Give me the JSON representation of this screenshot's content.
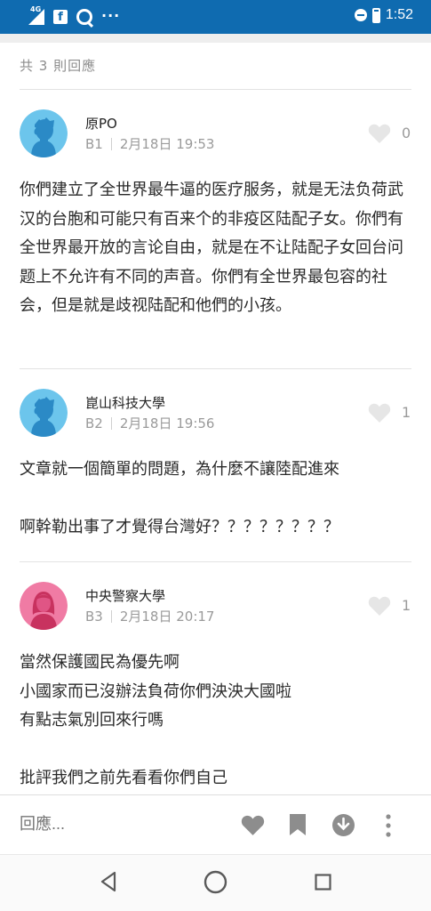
{
  "status_bar": {
    "network": "4G",
    "time": "1:52",
    "icons": [
      "signal-icon",
      "facebook-icon",
      "q-app-icon",
      "more-notifications-icon",
      "do-not-disturb-icon",
      "battery-icon"
    ]
  },
  "reply_count": "共 3 則回應",
  "replies": [
    {
      "author": "原PO",
      "floor": "B1",
      "date": "2月18日 19:53",
      "likes": "0",
      "avatar": "male-avatar-icon",
      "avatar_color": "#6cc5ec",
      "text": "你們建立了全世界最牛逼的医疗服务，就是无法负荷武汉的台胞和可能只有百来个的非疫区陆配子女。你們有全世界最开放的言论自由，就是在不让陆配子女回台问题上不允许有不同的声音。你們有全世界最包容的社会，但是就是歧视陆配和他們的小孩。"
    },
    {
      "author": "崑山科技大學",
      "floor": "B2",
      "date": "2月18日 19:56",
      "likes": "1",
      "avatar": "male-avatar-icon",
      "avatar_color": "#6cc5ec",
      "text": "文章就一個簡單的問題，為什麼不讓陸配進來\n\n啊幹勒出事了才覺得台灣好？？？？？？？？"
    },
    {
      "author": "中央警察大學",
      "floor": "B3",
      "date": "2月18日 20:17",
      "likes": "1",
      "avatar": "female-avatar-icon",
      "avatar_color": "#f07ba4",
      "text": "當然保護國民為優先啊\n小國家而已沒辦法負荷你們泱泱大國啦\n有點志氣別回來行嗎\n\n批評我們之前先看看你們自己"
    }
  ],
  "bottom_bar": {
    "reply_placeholder": "回應...",
    "actions": [
      "like-heart-icon",
      "bookmark-icon",
      "download-icon",
      "more-options-icon"
    ]
  },
  "nav_bar": {
    "buttons": [
      "back-icon",
      "home-icon",
      "recent-apps-icon"
    ]
  },
  "colors": {
    "status_bar": "#0f6bb0",
    "icon_gray": "#8d8d8d",
    "heart_idle": "#e6e6e6",
    "text_secondary": "#9a9a9a"
  }
}
